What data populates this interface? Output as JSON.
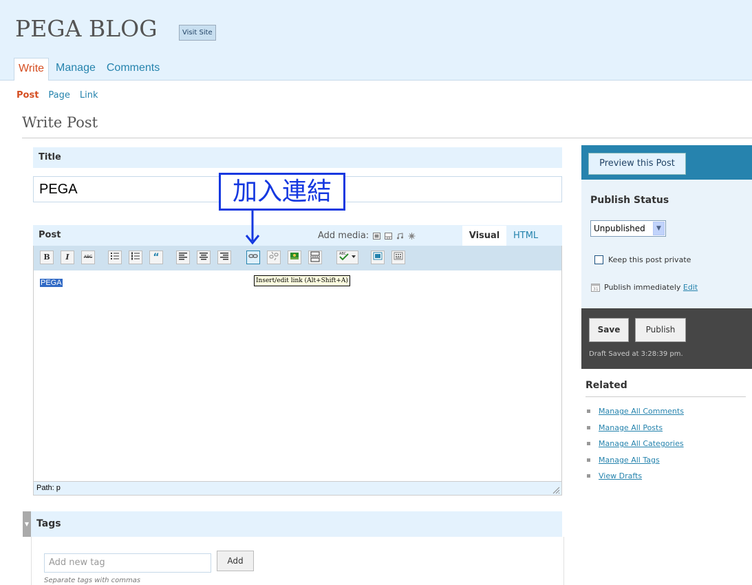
{
  "header": {
    "blog_title": "PEGA BLOG",
    "visit_site": "Visit Site",
    "menu": [
      {
        "label": "Write",
        "active": true
      },
      {
        "label": "Manage",
        "active": false
      },
      {
        "label": "Comments",
        "active": false
      }
    ]
  },
  "submenu": [
    {
      "label": "Post",
      "active": true
    },
    {
      "label": "Page",
      "active": false
    },
    {
      "label": "Link",
      "active": false
    }
  ],
  "page_title": "Write Post",
  "title_box": {
    "heading": "Title",
    "value": "PEGA"
  },
  "annotation": {
    "text": "加入連結",
    "color": "#1538e0"
  },
  "post_box": {
    "heading": "Post",
    "add_media_label": "Add media:",
    "tab_visual": "Visual",
    "tab_html": "HTML",
    "toolbar": {
      "bold": "B",
      "italic": "I",
      "strikethrough": "ABC",
      "blockquote": "“"
    },
    "tooltip": "Insert/edit link (Alt+Shift+A)",
    "content": "PEGA",
    "path": "Path: p"
  },
  "tags_box": {
    "heading": "Tags",
    "input_placeholder": "Add new tag",
    "add_button": "Add",
    "hint": "Separate tags with commas"
  },
  "sidebar": {
    "preview_button": "Preview this Post",
    "publish_status_title": "Publish Status",
    "status_value": "Unpublished",
    "private_label": "Keep this post private",
    "publish_when": "Publish immediately",
    "edit_link": "Edit",
    "save_button": "Save",
    "publish_button": "Publish",
    "draft_saved": "Draft Saved at 3:28:39 pm.",
    "related_title": "Related",
    "related_links": [
      "Manage All Comments",
      "Manage All Posts",
      "Manage All Categories",
      "Manage All Tags",
      "View Drafts"
    ]
  },
  "colors": {
    "accent_link": "#2583ad",
    "active_orange": "#d54e21",
    "header_bg": "#e4f2fd",
    "sidebar_blue": "#2683ae",
    "sidebar_dark": "#464646"
  }
}
